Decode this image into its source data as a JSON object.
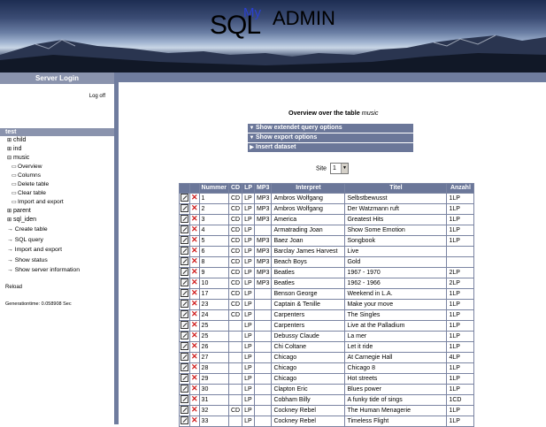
{
  "logo": {
    "my": "My",
    "sql": "SQL",
    "admin": "ADMIN"
  },
  "sidebar": {
    "header": "Server Login",
    "logoff": "Log off",
    "databases": [
      {
        "label": "test",
        "glyph": "",
        "selected": true
      },
      {
        "label": "child",
        "glyph": "⊞"
      },
      {
        "label": "ind",
        "glyph": "⊞"
      },
      {
        "label": "music",
        "glyph": "⊟"
      }
    ],
    "music_items": [
      "Overview",
      "Columns",
      "Delete table",
      "Clear table",
      "Import and export"
    ],
    "more_databases": [
      {
        "label": "parent",
        "glyph": "⊞"
      },
      {
        "label": "sql_iden",
        "glyph": "⊞"
      }
    ],
    "actions": [
      "Create table",
      "SQL query",
      "Import and export",
      "Show status",
      "Show server information"
    ],
    "reload": "Reload",
    "gentime": "Generationtime: 0.058908 Sec"
  },
  "main": {
    "overview_label": "Overview over the table",
    "table_name": "music",
    "bars": [
      "Show extendet query options",
      "Show export options",
      "Insert dataset"
    ],
    "site_label": "Site",
    "site_value": "1"
  },
  "table": {
    "headers": [
      "Nummer",
      "CD",
      "LP",
      "MP3",
      "Interpret",
      "Titel",
      "Anzahl"
    ],
    "rows": [
      [
        "1",
        "CD",
        "LP",
        "MP3",
        "Ambros Wolfgang",
        "Selbstbewusst",
        "1LP"
      ],
      [
        "2",
        "CD",
        "LP",
        "MP3",
        "Ambros Wolfgang",
        "Der Watzmann ruft",
        "1LP"
      ],
      [
        "3",
        "CD",
        "LP",
        "MP3",
        "America",
        "Greatest Hits",
        "1LP"
      ],
      [
        "4",
        "CD",
        "LP",
        "",
        "Armatrading Joan",
        "Show Some Emotion",
        "1LP"
      ],
      [
        "5",
        "CD",
        "LP",
        "MP3",
        "Baez Joan",
        "Songbook",
        "1LP"
      ],
      [
        "6",
        "CD",
        "LP",
        "MP3",
        "Barclay James Harvest",
        "Live",
        ""
      ],
      [
        "8",
        "CD",
        "LP",
        "MP3",
        "Beach Boys",
        "Gold",
        ""
      ],
      [
        "9",
        "CD",
        "LP",
        "MP3",
        "Beatles",
        "1967 - 1970",
        "2LP"
      ],
      [
        "10",
        "CD",
        "LP",
        "MP3",
        "Beatles",
        "1962 - 1966",
        "2LP"
      ],
      [
        "17",
        "CD",
        "LP",
        "",
        "Benson George",
        "Weekend in L.A.",
        "1LP"
      ],
      [
        "23",
        "CD",
        "LP",
        "",
        "Captain & Tenille",
        "Make your move",
        "1LP"
      ],
      [
        "24",
        "CD",
        "LP",
        "",
        "Carpenters",
        "The Singles",
        "1LP"
      ],
      [
        "25",
        "",
        "LP",
        "",
        "Carpenters",
        "Live at the Palladium",
        "1LP"
      ],
      [
        "25",
        "",
        "LP",
        "",
        "Debussy Claude",
        "La mer",
        "1LP"
      ],
      [
        "26",
        "",
        "LP",
        "",
        "Chi Coltane",
        "Let it ride",
        "1LP"
      ],
      [
        "27",
        "",
        "LP",
        "",
        "Chicago",
        "At Carnegie Hall",
        "4LP"
      ],
      [
        "28",
        "",
        "LP",
        "",
        "Chicago",
        "Chicago 8",
        "1LP"
      ],
      [
        "29",
        "",
        "LP",
        "",
        "Chicago",
        "Hot streets",
        "1LP"
      ],
      [
        "30",
        "",
        "LP",
        "",
        "Clapton Eric",
        "Blues power",
        "1LP"
      ],
      [
        "31",
        "",
        "LP",
        "",
        "Cobham Billy",
        "A funky tide of sings",
        "1CD"
      ],
      [
        "32",
        "CD",
        "LP",
        "",
        "Cockney Rebel",
        "The Human Menagerie",
        "1LP"
      ],
      [
        "33",
        "",
        "LP",
        "",
        "Cockney Rebel",
        "Timeless Flight",
        "1LP"
      ]
    ]
  }
}
